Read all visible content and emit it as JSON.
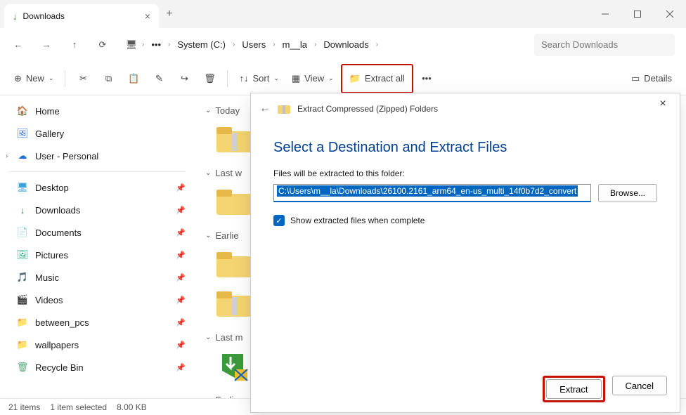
{
  "titlebar": {
    "tab_title": "Downloads"
  },
  "breadcrumb": {
    "monitor_icon": "pc-icon",
    "items": [
      "System (C:)",
      "Users",
      "m__la",
      "Downloads"
    ]
  },
  "search": {
    "placeholder": "Search Downloads"
  },
  "toolbar": {
    "new": "New",
    "sort": "Sort",
    "view": "View",
    "extract_all": "Extract all",
    "details": "Details"
  },
  "sidebar": {
    "top": [
      {
        "icon": "home-icon",
        "label": "Home"
      },
      {
        "icon": "gallery-icon",
        "label": "Gallery"
      },
      {
        "icon": "cloud-icon",
        "label": "User - Personal",
        "expandable": true
      }
    ],
    "pinned": [
      {
        "icon": "desktop-icon",
        "label": "Desktop"
      },
      {
        "icon": "downloads-icon",
        "label": "Downloads"
      },
      {
        "icon": "documents-icon",
        "label": "Documents"
      },
      {
        "icon": "pictures-icon",
        "label": "Pictures"
      },
      {
        "icon": "music-icon",
        "label": "Music"
      },
      {
        "icon": "videos-icon",
        "label": "Videos"
      },
      {
        "icon": "folder-icon",
        "label": "between_pcs"
      },
      {
        "icon": "folder-icon",
        "label": "wallpapers"
      },
      {
        "icon": "recycle-icon",
        "label": "Recycle Bin"
      }
    ]
  },
  "content": {
    "groups": [
      "Today",
      "Last w",
      "Earlie",
      "Last m",
      "Earlie"
    ]
  },
  "statusbar": {
    "items_count": "21 items",
    "selection": "1 item selected",
    "size": "8.00 KB"
  },
  "dialog": {
    "title": "Extract Compressed (Zipped) Folders",
    "heading": "Select a Destination and Extract Files",
    "label": "Files will be extracted to this folder:",
    "path": "C:\\Users\\m__la\\Downloads\\26100.2161_arm64_en-us_multi_14f0b7d2_convert",
    "browse": "Browse...",
    "checkbox": "Show extracted files when complete",
    "extract": "Extract",
    "cancel": "Cancel"
  }
}
